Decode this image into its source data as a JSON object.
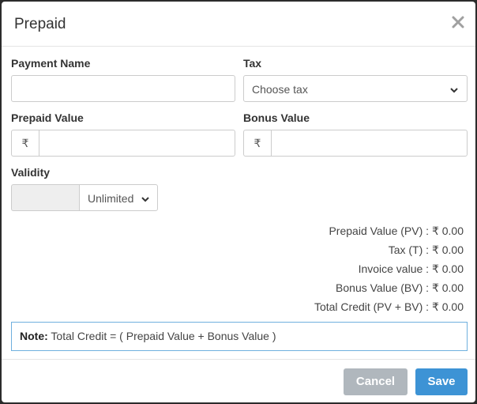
{
  "modal": {
    "title": "Prepaid"
  },
  "form": {
    "payment_name": {
      "label": "Payment Name",
      "value": ""
    },
    "tax": {
      "label": "Tax",
      "selected": "Choose tax"
    },
    "prepaid_value": {
      "label": "Prepaid Value",
      "currency": "₹",
      "value": ""
    },
    "bonus_value": {
      "label": "Bonus Value",
      "currency": "₹",
      "value": ""
    },
    "validity": {
      "label": "Validity",
      "value": "",
      "selected": "Unlimited"
    }
  },
  "summary": {
    "rows": [
      {
        "label": "Prepaid Value (PV) : ",
        "value": "₹ 0.00"
      },
      {
        "label": "Tax (T) : ",
        "value": "₹ 0.00"
      },
      {
        "label": "Invoice value : ",
        "value": "₹ 0.00"
      },
      {
        "label": "Bonus Value (BV) : ",
        "value": "₹ 0.00"
      },
      {
        "label": "Total Credit (PV + BV) : ",
        "value": "₹ 0.00"
      }
    ]
  },
  "note": {
    "prefix": "Note:",
    "text": " Total Credit = ( Prepaid Value + Bonus Value )"
  },
  "footer": {
    "cancel_label": "Cancel",
    "save_label": "Save"
  },
  "colors": {
    "save": "#3d93d5",
    "cancel": "#b0b7bd",
    "note_border": "#6fb0de"
  },
  "icons": {
    "close": "close-icon",
    "tax_dropdown": "chevron-down-icon",
    "validity_dropdown": "chevron-down-icon"
  }
}
